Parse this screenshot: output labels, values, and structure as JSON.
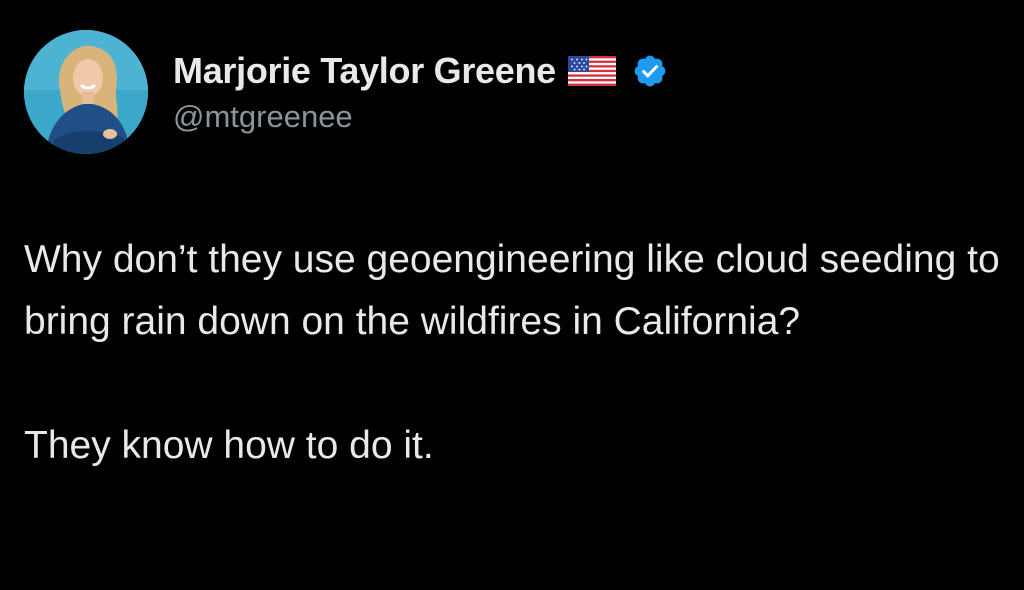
{
  "author": {
    "display_name": "Marjorie Taylor Greene",
    "handle": "@mtgreenee",
    "flag_icon": "us-flag-icon",
    "verified_icon": "verified-badge-icon",
    "verified_color": "#1d9bf0"
  },
  "tweet": {
    "paragraphs": [
      "Why don’t they use geoengineering like cloud seeding to bring rain down on the wildfires in California?",
      "They know how to do it."
    ]
  },
  "colors": {
    "background": "#000000",
    "text": "#e7e9ea",
    "secondary_text": "#8b949a"
  }
}
